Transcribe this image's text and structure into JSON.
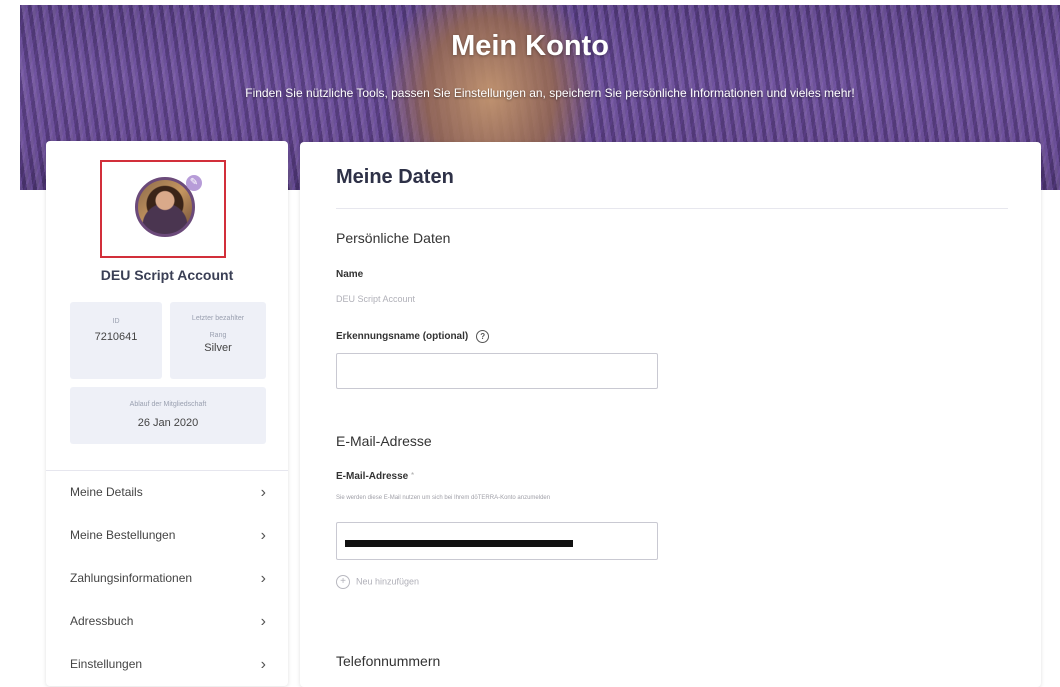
{
  "header": {
    "title": "Mein Konto",
    "subtitle": "Finden Sie nützliche Tools, passen Sie Einstellungen an, speichern Sie persönliche Informationen und vieles mehr!"
  },
  "profile": {
    "name": "DEU Script Account",
    "id_label": "ID",
    "id_value": "7210641",
    "rank_label_1": "Letzter bezahlter",
    "rank_label_2": "Rang",
    "rank_value": "Silver",
    "expiry_label": "Ablauf der Mitgliedschaft",
    "expiry_value": "26 Jan 2020",
    "edit_icon": "edit-icon",
    "avatar_icon": "avatar-photo"
  },
  "menu": {
    "items": [
      {
        "label": "Meine Details"
      },
      {
        "label": "Meine Bestellungen"
      },
      {
        "label": "Zahlungsinformationen"
      },
      {
        "label": "Adressbuch"
      },
      {
        "label": "Einstellungen"
      }
    ],
    "chevron": "›"
  },
  "main": {
    "title": "Meine Daten",
    "personal_section": "Persönliche Daten",
    "name_label": "Name",
    "name_value": "DEU Script Account",
    "nickname_label": "Erkennungsname (optional)",
    "nickname_value": "",
    "help_glyph": "?",
    "email_section": "E-Mail-Adresse",
    "email_label": "E-Mail-Adresse",
    "email_required": "*",
    "email_hint": "Sie werden diese E-Mail nutzen um sich bei Ihrem dōTERRA-Konto anzumelden",
    "add_label": "Neu hinzufügen",
    "add_glyph": "+",
    "phone_section": "Telefonnummern"
  },
  "colors": {
    "highlight": "#d22f3a",
    "heading": "#2e3147",
    "stat_bg": "#eef0f7"
  }
}
